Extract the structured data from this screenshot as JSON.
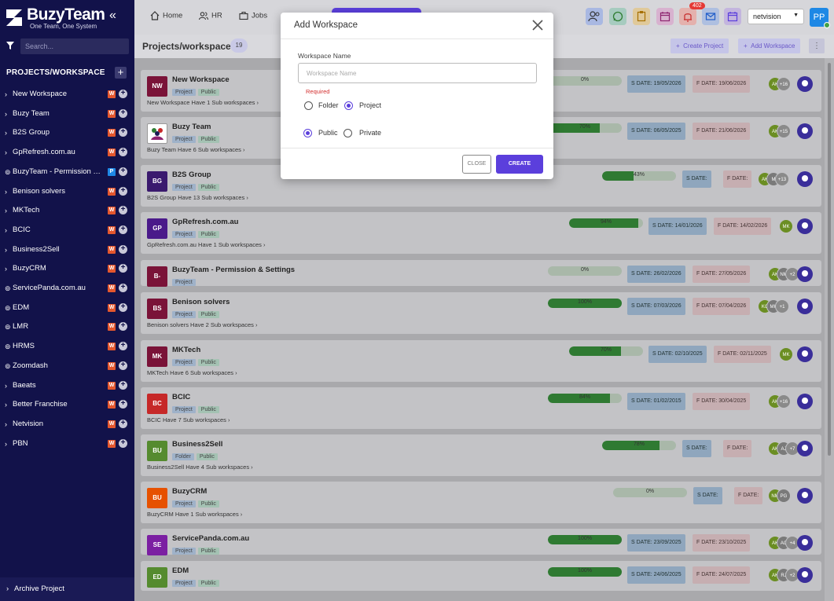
{
  "brand": {
    "name": "BuzyTeam",
    "tagline": "One Team, One System"
  },
  "sidebar": {
    "search_placeholder": "Search...",
    "heading": "PROJECTS/WORKSPACE",
    "items": [
      {
        "label": "New Workspace",
        "badge": "W",
        "badge_color": "#e4572e",
        "kind": "chevron"
      },
      {
        "label": "Buzy Team",
        "badge": "W",
        "badge_color": "#e4572e",
        "kind": "chevron"
      },
      {
        "label": "B2S Group",
        "badge": "W",
        "badge_color": "#e4572e",
        "kind": "chevron"
      },
      {
        "label": "GpRefresh.com.au",
        "badge": "W",
        "badge_color": "#e4572e",
        "kind": "chevron"
      },
      {
        "label": "BuzyTeam - Permission & S...",
        "badge": "P",
        "badge_color": "#1e88e5",
        "kind": "link"
      },
      {
        "label": "Benison solvers",
        "badge": "W",
        "badge_color": "#e4572e",
        "kind": "chevron"
      },
      {
        "label": "MKTech",
        "badge": "W",
        "badge_color": "#e4572e",
        "kind": "chevron"
      },
      {
        "label": "BCIC",
        "badge": "W",
        "badge_color": "#e4572e",
        "kind": "chevron"
      },
      {
        "label": "Business2Sell",
        "badge": "W",
        "badge_color": "#e4572e",
        "kind": "chevron"
      },
      {
        "label": "BuzyCRM",
        "badge": "W",
        "badge_color": "#e4572e",
        "kind": "chevron"
      },
      {
        "label": "ServicePanda.com.au",
        "badge": "W",
        "badge_color": "#e4572e",
        "kind": "link"
      },
      {
        "label": "EDM",
        "badge": "W",
        "badge_color": "#e4572e",
        "kind": "link"
      },
      {
        "label": "LMR",
        "badge": "W",
        "badge_color": "#e4572e",
        "kind": "link"
      },
      {
        "label": "HRMS",
        "badge": "W",
        "badge_color": "#e4572e",
        "kind": "link"
      },
      {
        "label": "Zoomdash",
        "badge": "W",
        "badge_color": "#e4572e",
        "kind": "link"
      },
      {
        "label": "Baeats",
        "badge": "W",
        "badge_color": "#e4572e",
        "kind": "chevron"
      },
      {
        "label": "Better Franchise",
        "badge": "W",
        "badge_color": "#e4572e",
        "kind": "chevron"
      },
      {
        "label": "Netvision",
        "badge": "W",
        "badge_color": "#e4572e",
        "kind": "chevron"
      },
      {
        "label": "PBN",
        "badge": "W",
        "badge_color": "#e4572e",
        "kind": "chevron"
      }
    ],
    "archive_label": "Archive Project"
  },
  "topbar": {
    "nav": [
      {
        "label": "Home",
        "icon": "home-icon"
      },
      {
        "label": "HR",
        "icon": "users-icon"
      },
      {
        "label": "Jobs",
        "icon": "briefcase-icon"
      }
    ],
    "notification_count": "402",
    "company_select": "netvision",
    "user_initials": "PP"
  },
  "page": {
    "title": "Projects/workspace",
    "count": "19",
    "create_project_label": "Create Project",
    "add_workspace_label": "Add Workspace"
  },
  "cards": [
    {
      "initials": "NW",
      "avatar_color": "#7a1338",
      "title": "New Workspace",
      "tags": [
        "Project",
        "Public"
      ],
      "sub": "New Workspace Have 1 Sub workspaces",
      "progress": 0,
      "progress_label": "0%",
      "s_date": "S DATE:  19/05/2026",
      "f_date": "F DATE:  19/06/2026",
      "members": [
        "AK",
        "+16"
      ]
    },
    {
      "initials": "",
      "avatar_color": "#ffffff",
      "title": "Buzy Team",
      "tags": [
        "Project",
        "Public"
      ],
      "sub": "Buzy Team Have 6 Sub workspaces",
      "progress": 70,
      "progress_label": "70%",
      "s_date": "S DATE:  06/05/2025",
      "f_date": "F DATE:  21/06/2026",
      "members": [
        "AK",
        "+15"
      ]
    },
    {
      "initials": "BG",
      "avatar_color": "#3a1a6e",
      "title": "B2S Group",
      "tags": [
        "Project",
        "Public"
      ],
      "sub": "B2S Group Have 13 Sub workspaces",
      "progress": 43,
      "progress_label": "43%",
      "s_date": "S DATE:",
      "f_date": "F DATE:",
      "members": [
        "AK",
        "M",
        "+13"
      ]
    },
    {
      "initials": "GP",
      "avatar_color": "#4a1a8a",
      "title": "GpRefresh.com.au",
      "tags": [
        "Project",
        "Public"
      ],
      "sub": "GpRefresh.com.au Have 1 Sub workspaces",
      "progress": 94,
      "progress_label": "94%",
      "s_date": "S DATE:  14/01/2026",
      "f_date": "F DATE:  14/02/2026",
      "members": [
        "MK"
      ]
    },
    {
      "initials": "B-",
      "avatar_color": "#7a1338",
      "title": "BuzyTeam - Permission & Settings",
      "tags": [
        "Project"
      ],
      "sub": "",
      "progress": 0,
      "progress_label": "0%",
      "s_date": "S DATE:  26/02/2026",
      "f_date": "F DATE:  27/05/2026",
      "members": [
        "AK",
        "NM",
        "+2"
      ]
    },
    {
      "initials": "BS",
      "avatar_color": "#7a1338",
      "title": "Benison solvers",
      "tags": [
        "Project",
        "Public"
      ],
      "sub": "Benison solvers Have 2 Sub workspaces",
      "progress": 100,
      "progress_label": "100%",
      "s_date": "S DATE:  07/03/2026",
      "f_date": "F DATE:  07/04/2026",
      "members": [
        "KC",
        "MK",
        "+1"
      ]
    },
    {
      "initials": "MK",
      "avatar_color": "#7a1338",
      "title": "MKTech",
      "tags": [
        "Project",
        "Public"
      ],
      "sub": "MKTech Have 6 Sub workspaces",
      "progress": 70,
      "progress_label": "70%",
      "s_date": "S DATE:  02/10/2025",
      "f_date": "F DATE:  02/11/2025",
      "members": [
        "MK"
      ]
    },
    {
      "initials": "BC",
      "avatar_color": "#c62828",
      "title": "BCIC",
      "tags": [
        "Project",
        "Public"
      ],
      "sub": "BCIC Have 7 Sub workspaces",
      "progress": 84,
      "progress_label": "84%",
      "s_date": "S DATE:  01/02/2015",
      "f_date": "F DATE:  30/04/2025",
      "members": [
        "AK",
        "+16"
      ]
    },
    {
      "initials": "BU",
      "avatar_color": "#558b2f",
      "title": "Business2Sell",
      "tags": [
        "Folder",
        "Public"
      ],
      "sub": "Business2Sell Have 4 Sub workspaces",
      "progress": 78,
      "progress_label": "78%",
      "s_date": "S DATE:",
      "f_date": "F DATE:",
      "members": [
        "AK",
        "AJ",
        "+7"
      ]
    },
    {
      "initials": "BU",
      "avatar_color": "#e65100",
      "title": "BuzyCRM",
      "tags": [
        "Project",
        "Public"
      ],
      "sub": "BuzyCRM Have 1 Sub workspaces",
      "progress": 0,
      "progress_label": "0%",
      "s_date": "S DATE:",
      "f_date": "F DATE:",
      "members": [
        "NM",
        "PG"
      ]
    },
    {
      "initials": "SE",
      "avatar_color": "#7b1fa2",
      "title": "ServicePanda.com.au",
      "tags": [
        "Project",
        "Public"
      ],
      "sub": "",
      "progress": 100,
      "progress_label": "100%",
      "s_date": "S DATE:  23/09/2025",
      "f_date": "F DATE:  23/10/2025",
      "members": [
        "AK",
        "AC",
        "+4"
      ]
    },
    {
      "initials": "ED",
      "avatar_color": "#558b2f",
      "title": "EDM",
      "tags": [
        "Project",
        "Public"
      ],
      "sub": "",
      "progress": 100,
      "progress_label": "100%",
      "s_date": "S DATE:  24/06/2025",
      "f_date": "F DATE:  24/07/2025",
      "members": [
        "AK",
        "RJ",
        "+2"
      ]
    }
  ],
  "modal": {
    "title": "Add Workspace",
    "field_label": "Workspace Name",
    "field_placeholder": "Workspace Name",
    "required_text": "Required",
    "type_options": [
      "Folder",
      "Project"
    ],
    "type_selected": "Project",
    "visibility_options": [
      "Public",
      "Private"
    ],
    "visibility_selected": "Public",
    "cancel_label": "CLOSE",
    "create_label": "CREATE"
  },
  "colors": {
    "accent": "#5b3fdc",
    "sidebar": "#12124a",
    "progress": "#2f7a32"
  }
}
